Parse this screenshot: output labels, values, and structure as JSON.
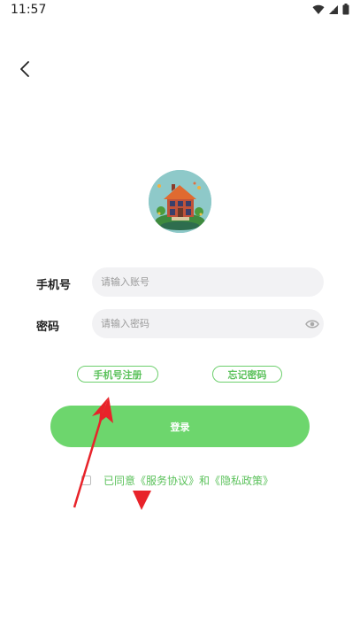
{
  "status_bar": {
    "time": "11:57"
  },
  "form": {
    "phone_label": "手机号",
    "phone_placeholder": "请输入账号",
    "password_label": "密码",
    "password_placeholder": "请输入密码"
  },
  "links": {
    "register_label": "手机号注册",
    "forgot_label": "忘记密码"
  },
  "login": {
    "button_label": "登录"
  },
  "agreement": {
    "prefix": "已同意",
    "service_link": "《服务协议》",
    "and": "和",
    "privacy_link": "《隐私政策》",
    "checked": false
  },
  "colors": {
    "accent_green": "#6dd66d",
    "annotation_red": "#e8232a"
  },
  "icons": {
    "back": "chevron-left-icon",
    "eye": "eye-icon",
    "wifi": "wifi-icon",
    "signal": "signal-icon",
    "battery": "battery-icon"
  }
}
